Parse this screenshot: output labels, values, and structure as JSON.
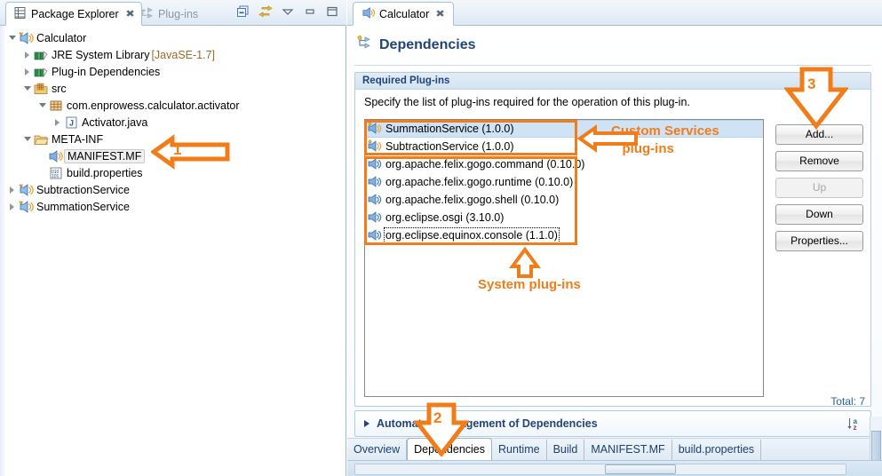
{
  "left_view": {
    "tabs": [
      {
        "label": "Package Explorer",
        "icon": "package-explorer-icon",
        "active": true,
        "closable": true
      },
      {
        "label": "Plug-ins",
        "icon": "plugins-icon",
        "active": false,
        "closable": false
      }
    ],
    "toolbar_icons": [
      "collapse-all-icon",
      "link-with-editor-icon",
      "view-menu-icon",
      "minimize-icon",
      "maximize-icon"
    ],
    "tree": [
      {
        "label": "Calculator",
        "suffix": "",
        "indent": 0,
        "twisty": "expanded",
        "icon": "plugin-project-icon"
      },
      {
        "label": "JRE System Library",
        "suffix": " [JavaSE-1.7]",
        "indent": 1,
        "twisty": "collapsed",
        "icon": "library-icon"
      },
      {
        "label": "Plug-in Dependencies",
        "suffix": "",
        "indent": 1,
        "twisty": "collapsed",
        "icon": "library-icon"
      },
      {
        "label": "src",
        "suffix": "",
        "indent": 1,
        "twisty": "expanded",
        "icon": "source-folder-icon"
      },
      {
        "label": "com.enprowess.calculator.activator",
        "suffix": "",
        "indent": 2,
        "twisty": "expanded",
        "icon": "package-icon"
      },
      {
        "label": "Activator.java",
        "suffix": "",
        "indent": 3,
        "twisty": "collapsed",
        "icon": "java-file-icon"
      },
      {
        "label": "META-INF",
        "suffix": "",
        "indent": 1,
        "twisty": "expanded",
        "icon": "folder-icon"
      },
      {
        "label": "MANIFEST.MF",
        "suffix": "",
        "indent": 2,
        "twisty": "none",
        "icon": "manifest-icon",
        "selected": true
      },
      {
        "label": "build.properties",
        "suffix": "",
        "indent": 2,
        "twisty": "none",
        "icon": "properties-file-icon"
      },
      {
        "label": "SubtractionService",
        "suffix": "",
        "indent": 0,
        "twisty": "collapsed",
        "icon": "plugin-project-icon"
      },
      {
        "label": "SummationService",
        "suffix": "",
        "indent": 0,
        "twisty": "collapsed",
        "icon": "plugin-project-icon"
      }
    ]
  },
  "editor": {
    "tab": {
      "label": "Calculator",
      "icon": "manifest-icon",
      "close_glyph": "✕"
    },
    "form_title": "Dependencies",
    "form_title_icon": "dependencies-icon",
    "sort_icon": "sort-az-icon",
    "section": {
      "header": "Required Plug-ins",
      "description": "Specify the list of plug-ins required for the operation of this plug-in.",
      "total_label": "Total: 7",
      "items": [
        {
          "name": "SummationService (1.0.0)",
          "selected": true,
          "focused": false,
          "group": "custom"
        },
        {
          "name": "SubtractionService (1.0.0)",
          "selected": false,
          "focused": false,
          "group": "custom"
        },
        {
          "name": "org.apache.felix.gogo.command (0.10.0)",
          "selected": false,
          "focused": false,
          "group": "system"
        },
        {
          "name": "org.apache.felix.gogo.runtime (0.10.0)",
          "selected": false,
          "focused": false,
          "group": "system"
        },
        {
          "name": "org.apache.felix.gogo.shell (0.10.0)",
          "selected": false,
          "focused": false,
          "group": "system"
        },
        {
          "name": "org.eclipse.osgi (3.10.0)",
          "selected": false,
          "focused": false,
          "group": "system"
        },
        {
          "name": "org.eclipse.equinox.console (1.1.0)",
          "selected": false,
          "focused": true,
          "group": "system"
        }
      ],
      "buttons": [
        {
          "label": "Add...",
          "enabled": true
        },
        {
          "label": "Remove",
          "enabled": true
        },
        {
          "label": "Up",
          "enabled": false
        },
        {
          "label": "Down",
          "enabled": true
        },
        {
          "label": "Properties...",
          "enabled": true
        }
      ]
    },
    "auto_section": {
      "label": "Automated Management of Dependencies",
      "sort_icon": "sort-az-icon"
    },
    "page_tabs": [
      {
        "label": "Overview",
        "active": false
      },
      {
        "label": "Dependencies",
        "active": true
      },
      {
        "label": "Runtime",
        "active": false
      },
      {
        "label": "Build",
        "active": false
      },
      {
        "label": "MANIFEST.MF",
        "active": false
      },
      {
        "label": "build.properties",
        "active": false
      }
    ]
  },
  "annotations": {
    "accent_color": "#f07d1a",
    "callout_1": "1",
    "callout_2": "2",
    "callout_3": "3",
    "custom_services_label": "Custom Services\n   plug-ins",
    "system_plugins_label": "System plug-ins"
  }
}
